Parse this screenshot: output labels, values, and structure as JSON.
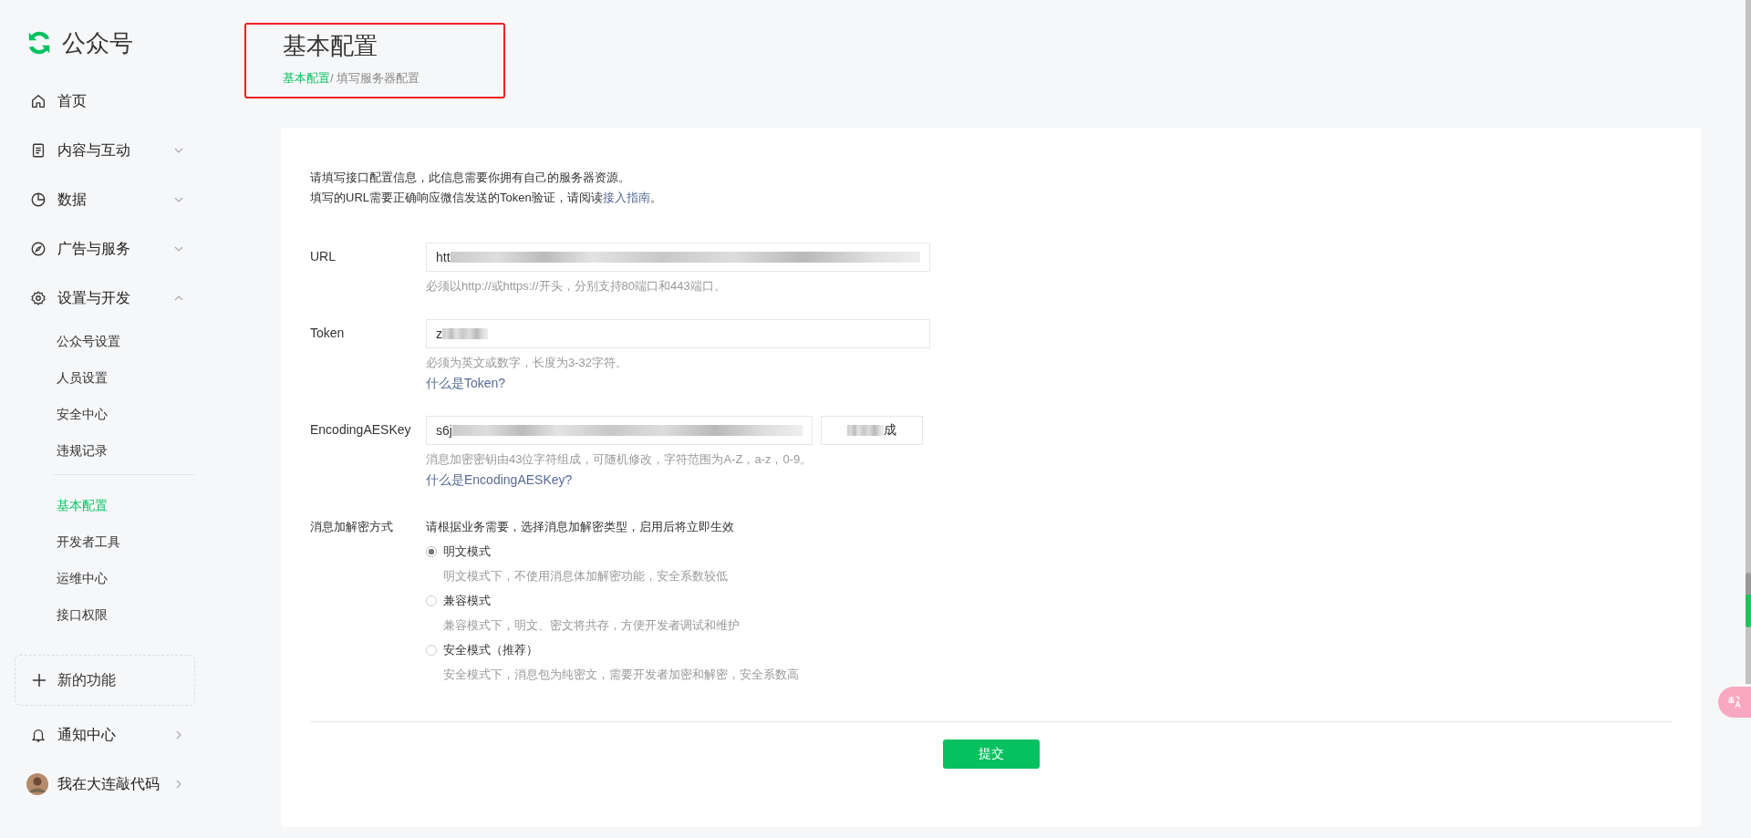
{
  "sidebar": {
    "brand": "公众号",
    "items": [
      {
        "label": "首页"
      },
      {
        "label": "内容与互动",
        "expanded": false
      },
      {
        "label": "数据",
        "expanded": false
      },
      {
        "label": "广告与服务",
        "expanded": false
      },
      {
        "label": "设置与开发",
        "expanded": true,
        "children": [
          {
            "label": "公众号设置",
            "selected": false
          },
          {
            "label": "人员设置",
            "selected": false
          },
          {
            "label": "安全中心",
            "selected": false
          },
          {
            "label": "违规记录",
            "selected": false
          },
          {
            "kind": "divider"
          },
          {
            "label": "基本配置",
            "selected": true
          },
          {
            "label": "开发者工具",
            "selected": false
          },
          {
            "label": "运维中心",
            "selected": false
          },
          {
            "label": "接口权限",
            "selected": false
          }
        ]
      }
    ],
    "new_feature": "新的功能",
    "notifications": "通知中心",
    "user": "我在大连敲代码"
  },
  "header": {
    "title": "基本配置",
    "breadcrumb": [
      {
        "label": "基本配置",
        "current": false
      },
      {
        "label": "/ 填写服务器配置",
        "current": true
      }
    ]
  },
  "form": {
    "intro": [
      {
        "text": "请填写接口配置信息，此信息需要你拥有自己的服务器资源。"
      },
      {
        "text": "填写的URL需要正确响应微信发送的Token验证，请阅读",
        "link": "接入指南",
        "after": "。"
      }
    ],
    "fields": [
      {
        "label": "URL",
        "value": "htt",
        "hint": "必须以http://或https://开头，分别支持80端口和443端口。"
      },
      {
        "label": "Token",
        "value": "z",
        "hint": "必须为英文或数字，长度为3-32字符。",
        "link": "什么是Token?"
      },
      {
        "label": "EncodingAESKey",
        "value": "s6j",
        "hint": "消息加密密钥由43位字符组成，可随机修改，字符范围为A-Z，a-z，0-9。",
        "link": "什么是EncodingAESKey?",
        "button": "成"
      }
    ],
    "mode": {
      "label": "消息加解密方式",
      "note": "请根据业务需要，选择消息加解密类型，启用后将立即生效",
      "options": [
        {
          "label": "明文模式",
          "desc": "明文模式下，不使用消息体加解密功能，安全系数较低",
          "selected": true
        },
        {
          "label": "兼容模式",
          "desc": "兼容模式下，明文、密文将共存，方便开发者调试和维护",
          "selected": false
        },
        {
          "label": "安全模式（推荐）",
          "desc": "安全模式下，消息包为纯密文，需要开发者加密和解密，安全系数高",
          "selected": false
        }
      ]
    },
    "submit": "提交"
  }
}
